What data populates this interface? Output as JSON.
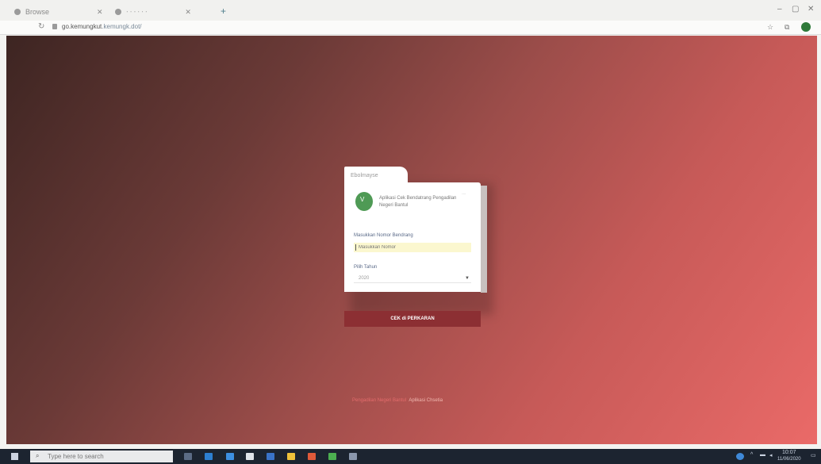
{
  "browser": {
    "tabs": [
      {
        "label": "Browse"
      },
      {
        "label": "ᐧ ᐧ ᐧ ᐧ ᐧ ᐧ"
      }
    ],
    "url_host": "go.kemungkut",
    "url_path": ".kemungk.dot/"
  },
  "card": {
    "tab_label": "Ebolmayse",
    "logo_glyph": "V",
    "app_name": "Aplikasi Cek Bendatrang Pengadilan Negeri Bantul",
    "field1_label": "Masukkan Nomor Bendrang",
    "field1_placeholder": "Masukkan Nomor",
    "field2_label": "Pilih Tahun",
    "field2_value": "2020",
    "submit_label": "CEK di PERKARAN"
  },
  "footer": {
    "link_text": "Pengadilan Negeri Bantul",
    "suffix_text": "Aplikasi Chsetia"
  },
  "taskbar": {
    "search_placeholder": "Type here to search",
    "time": "10:07",
    "date": "11/06/2020"
  },
  "colors": {
    "accent": "#8c2f33",
    "logo_green": "#4f9a55",
    "input_fill": "#fbf7cf"
  }
}
